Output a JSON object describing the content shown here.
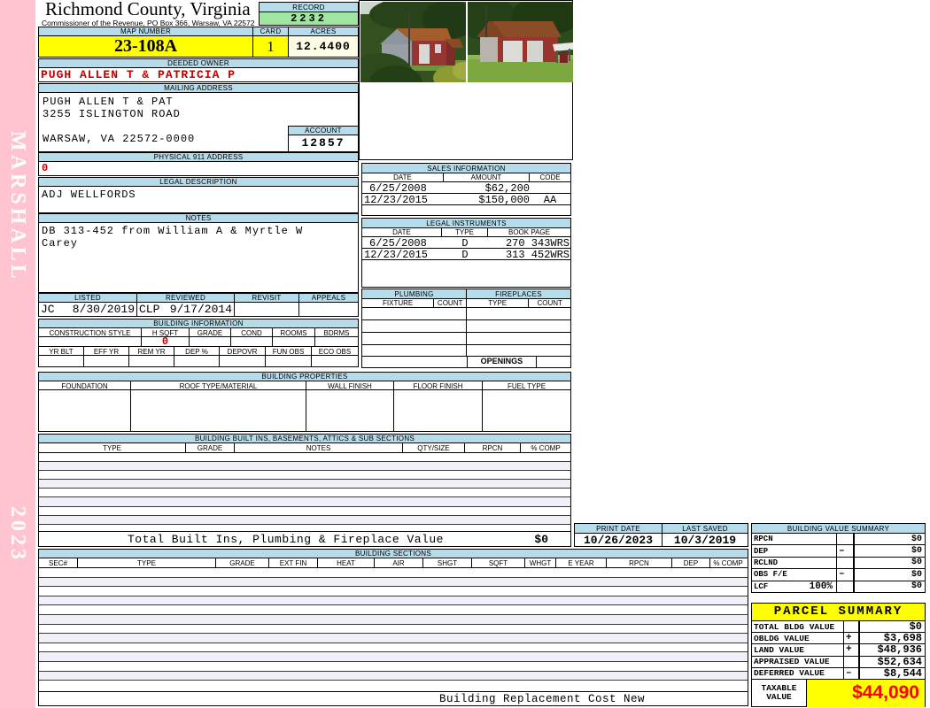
{
  "colors": {
    "header_blue": "#b6dbea",
    "record_green": "#9fe6a0",
    "highlight_yellow": "#ffff00",
    "acres_cream": "#fcfce6",
    "sidebar_pink": "#ffc4cf",
    "red_text": "#c00000",
    "taxable_red": "#ff0000"
  },
  "sidebar": {
    "vendor": "MARSHALL",
    "year": "2023"
  },
  "header": {
    "county": "Richmond County, Virginia",
    "subtitle": "Commissioner of the Revenue, PO Box 366, Warsaw, VA 22572",
    "record_label": "RECORD",
    "record": "2232",
    "map_number_label": "MAP NUMBER",
    "map_number": "23-108A",
    "card_label": "CARD",
    "card": "1",
    "acres_label": "ACRES",
    "acres": "12.4400"
  },
  "owner": {
    "deeded_owner_label": "DEEDED OWNER",
    "deeded_owner": "PUGH ALLEN T & PATRICIA P",
    "mailing_address_label": "MAILING ADDRESS",
    "mailing_line1": "PUGH ALLEN T & PAT",
    "mailing_line2": "3255 ISLINGTON ROAD",
    "mailing_line3": "WARSAW, VA 22572-0000",
    "account_label": "ACCOUNT",
    "account": "12857",
    "physical_address_label": "PHYSICAL 911 ADDRESS",
    "physical_address": "0",
    "legal_description_label": "LEGAL DESCRIPTION",
    "legal_description": "ADJ WELLFORDS",
    "notes_label": "NOTES",
    "notes_line1": "DB 313-452 from William A & Myrtle W",
    "notes_line2": "Carey"
  },
  "review": {
    "listed_label": "LISTED",
    "listed_by": "JC",
    "listed_date": "8/30/2019",
    "reviewed_label": "REVIEWED",
    "reviewed_by": "CLP",
    "reviewed_date": "9/17/2014",
    "revisit_label": "REVISIT",
    "appeals_label": "APPEALS"
  },
  "sales": {
    "title": "SALES INFORMATION",
    "columns": [
      "DATE",
      "AMOUNT",
      "CODE"
    ],
    "rows": [
      [
        "6/25/2008",
        "$62,200",
        ""
      ],
      [
        "12/23/2015",
        "$150,000",
        "AA"
      ]
    ]
  },
  "legal_instruments": {
    "title": "LEGAL INSTRUMENTS",
    "columns": [
      "DATE",
      "TYPE",
      "BOOK PAGE"
    ],
    "rows": [
      [
        "6/25/2008",
        "D",
        "270 343WRS"
      ],
      [
        "12/23/2015",
        "D",
        "313 452WRS"
      ]
    ]
  },
  "plumbing": {
    "title": "PLUMBING",
    "columns": [
      "FIXTURE",
      "COUNT"
    ]
  },
  "fireplaces": {
    "title": "FIREPLACES",
    "columns": [
      "TYPE",
      "COUNT"
    ],
    "openings_label": "OPENINGS"
  },
  "building_info": {
    "title": "BUILDING INFORMATION",
    "columns1": [
      "CONSTRUCTION STYLE",
      "H SQFT",
      "GRADE",
      "COND",
      "ROOMS",
      "BDRMS"
    ],
    "hsqft_value": "0",
    "columns2": [
      "YR BLT",
      "EFF YR",
      "REM YR",
      "DEP %",
      "DEPOVR",
      "FUN OBS",
      "ECO OBS"
    ]
  },
  "building_properties": {
    "title": "BUILDING PROPERTIES",
    "columns": [
      "FOUNDATION",
      "ROOF TYPE/MATERIAL",
      "WALL FINISH",
      "FLOOR FINISH",
      "FUEL TYPE"
    ]
  },
  "built_ins": {
    "title": "BUILDING BUILT INS, BASEMENTS, ATTICS & SUB SECTIONS",
    "columns": [
      "TYPE",
      "GRADE",
      "NOTES",
      "QTY/SIZE",
      "RPCN",
      "% COMP"
    ],
    "total_label": "Total Built Ins, Plumbing & Fireplace Value",
    "total_value": "$0"
  },
  "print_info": {
    "print_date_label": "PRINT DATE",
    "print_date": "10/26/2023",
    "last_saved_label": "LAST SAVED",
    "last_saved": "10/3/2019"
  },
  "building_value_summary": {
    "title": "BUILDING VALUE SUMMARY",
    "rows": [
      {
        "label": "RPCN",
        "extra": "",
        "op": "",
        "value": "$0"
      },
      {
        "label": "DEP",
        "extra": "",
        "op": "–",
        "value": "$0"
      },
      {
        "label": "RCLND",
        "extra": "",
        "op": "",
        "value": "$0"
      },
      {
        "label": "OBS F/E",
        "extra": "",
        "op": "–",
        "value": "$0"
      },
      {
        "label": "LCF",
        "extra": "100%",
        "op": "",
        "value": "$0"
      }
    ]
  },
  "building_sections": {
    "title": "BUILDING SECTIONS",
    "columns": [
      "SEC#",
      "TYPE",
      "GRADE",
      "EXT FIN",
      "HEAT",
      "AIR",
      "SHGT",
      "SQFT",
      "WHGT",
      "E YEAR",
      "RPCN",
      "DEP",
      "% COMP"
    ],
    "footer_note": "Building Replacement Cost New"
  },
  "parcel_summary": {
    "title": "PARCEL SUMMARY",
    "rows": [
      {
        "label": "TOTAL BLDG VALUE",
        "op": "",
        "value": "$0"
      },
      {
        "label": "OBLDG VALUE",
        "op": "+",
        "value": "$3,698"
      },
      {
        "label": "LAND VALUE",
        "op": "+",
        "value": "$48,936"
      },
      {
        "label": "APPRAISED VALUE",
        "op": "",
        "value": "$52,634"
      },
      {
        "label": "DEFERRED VALUE",
        "op": "–",
        "value": "$8,544"
      }
    ],
    "taxable_label": "TAXABLE VALUE",
    "taxable_value": "$44,090"
  }
}
